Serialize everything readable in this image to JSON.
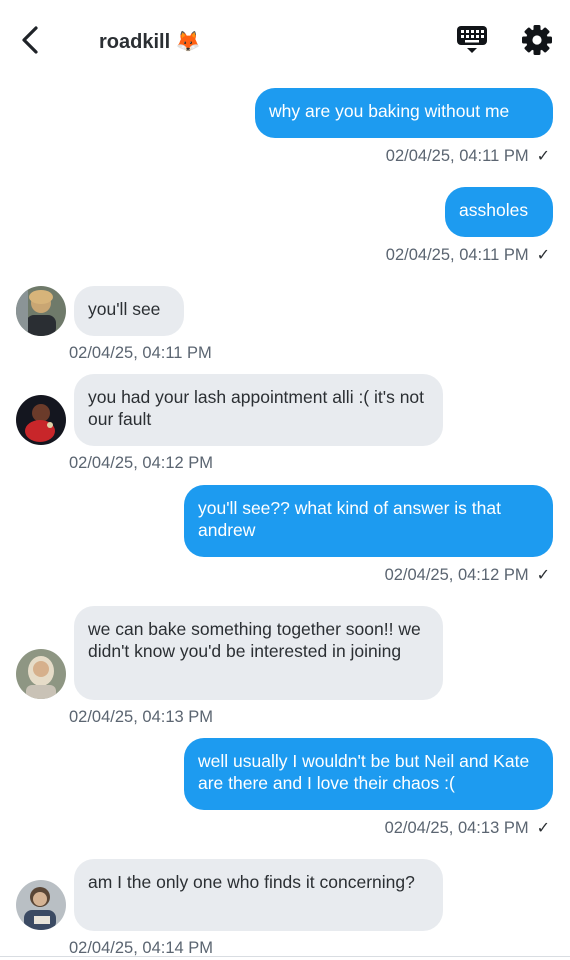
{
  "header": {
    "title": "roadkill 🦊"
  },
  "messages": [
    {
      "text": "why are you baking without me",
      "timestamp": "02/04/25, 04:11 PM"
    },
    {
      "text": "assholes",
      "timestamp": "02/04/25, 04:11 PM"
    },
    {
      "text": "you'll see",
      "timestamp": "02/04/25, 04:11 PM"
    },
    {
      "text": "you had your lash appointment alli :( it's not our fault",
      "timestamp": "02/04/25, 04:12 PM"
    },
    {
      "text": "you'll see?? what kind of answer is that andrew",
      "timestamp": "02/04/25, 04:12 PM"
    },
    {
      "text": "we can bake something together soon!! we didn't know you'd be interested in joining",
      "timestamp": "02/04/25, 04:13 PM"
    },
    {
      "text": "well usually I wouldn't be but Neil and Kate are there and I love their chaos :(",
      "timestamp": "02/04/25, 04:13 PM"
    },
    {
      "text": "am I the only one who finds it concerning?",
      "timestamp": "02/04/25, 04:14 PM"
    }
  ],
  "read_mark": "✓",
  "colors": {
    "outgoing_bubble": "#1d9bf0",
    "incoming_bubble": "#e8ebef",
    "timestamp": "#5b6571"
  },
  "icons": {
    "back": "chevron-left-icon",
    "keyboard": "keyboard-icon",
    "settings": "gear-icon"
  }
}
